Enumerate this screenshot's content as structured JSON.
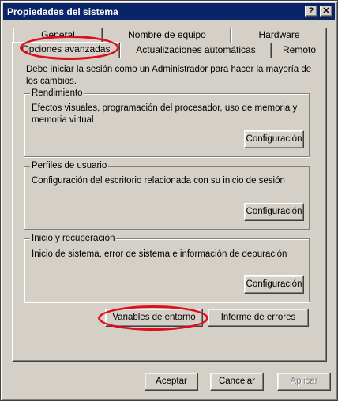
{
  "window": {
    "title": "Propiedades del sistema",
    "help_glyph": "?",
    "close_glyph": "✕"
  },
  "tabs": {
    "row_back": [
      {
        "label": "General"
      },
      {
        "label": "Nombre de equipo"
      },
      {
        "label": "Hardware"
      }
    ],
    "row_front": [
      {
        "label": "Opciones avanzadas",
        "selected": true
      },
      {
        "label": "Actualizaciones automáticas"
      },
      {
        "label": "Remoto"
      }
    ]
  },
  "panel": {
    "intro": "Debe iniciar la sesión como un Administrador para hacer la mayoría de los cambios.",
    "groups": [
      {
        "title": "Rendimiento",
        "description": "Efectos visuales, programación del procesador, uso de memoria y memoria virtual",
        "button": "Configuración"
      },
      {
        "title": "Perfiles de usuario",
        "description": "Configuración del escritorio relacionada con su inicio de sesión",
        "button": "Configuración"
      },
      {
        "title": "Inicio y recuperación",
        "description": "Inicio de sistema, error de sistema e información de depuración",
        "button": "Configuración"
      }
    ],
    "env_button": "Variables de entorno",
    "error_button": "Informe de errores"
  },
  "footer": {
    "accept": "Aceptar",
    "cancel": "Cancelar",
    "apply": "Aplicar",
    "apply_disabled": true
  },
  "colors": {
    "titlebar": "#0a246a",
    "face": "#d4d0c8",
    "annotation_ring": "#e0101a"
  }
}
